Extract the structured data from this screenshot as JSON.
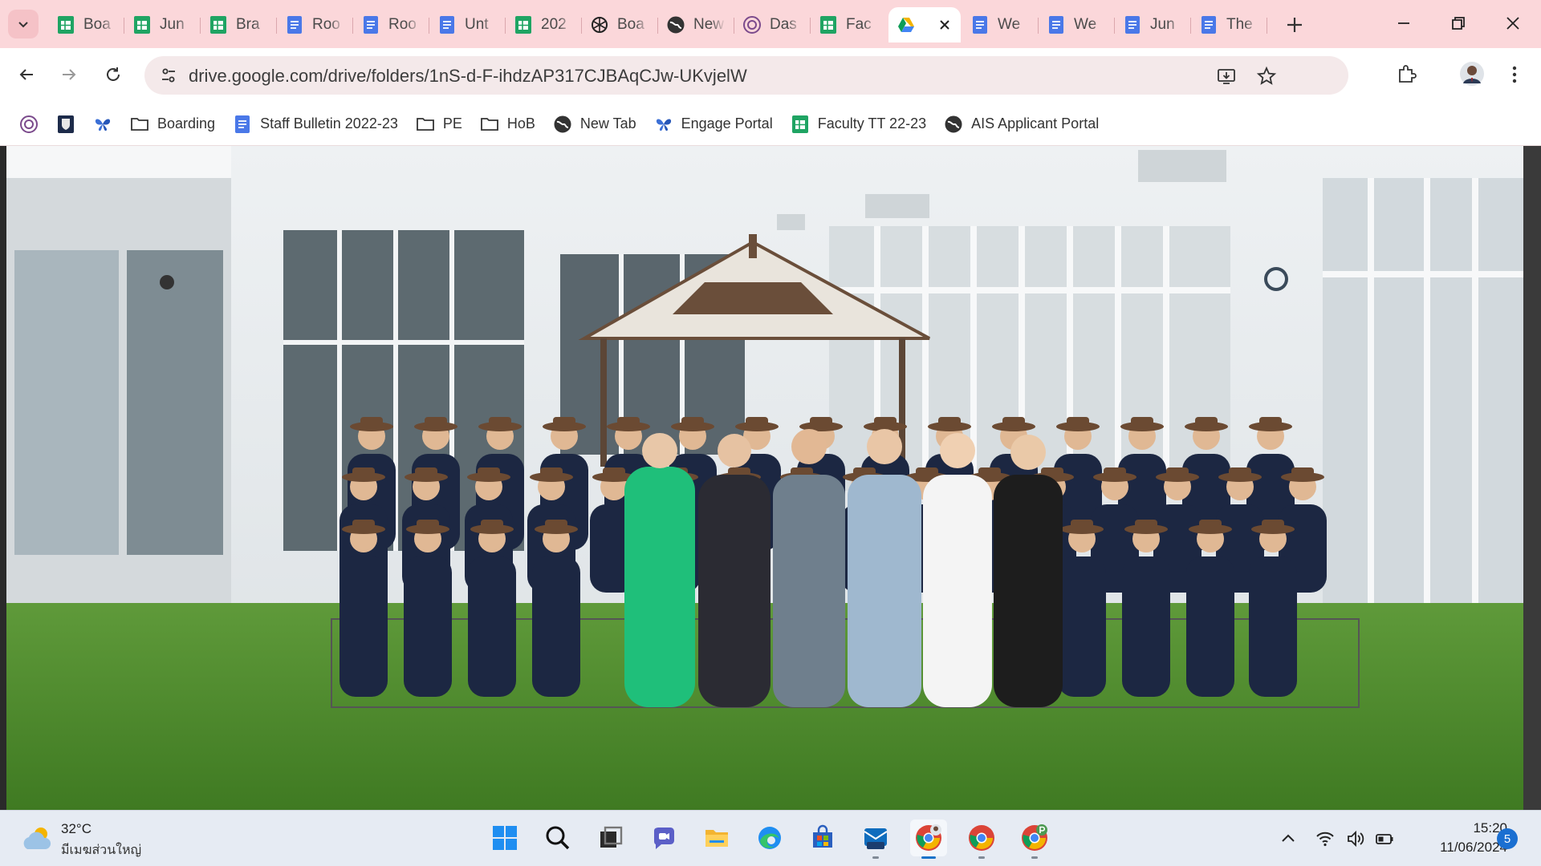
{
  "browser": {
    "tabs": [
      {
        "label": "Boa",
        "icon": "sheets-icon"
      },
      {
        "label": "Jun",
        "icon": "sheets-icon"
      },
      {
        "label": "Bra",
        "icon": "sheets-icon"
      },
      {
        "label": "Roo",
        "icon": "docs-icon"
      },
      {
        "label": "Roo",
        "icon": "docs-icon"
      },
      {
        "label": "Unt",
        "icon": "docs-icon"
      },
      {
        "label": "202",
        "icon": "sheets-icon"
      },
      {
        "label": "Boa",
        "icon": "openai-icon"
      },
      {
        "label": "New",
        "icon": "chrome-globe-icon"
      },
      {
        "label": "Das",
        "icon": "target-icon"
      },
      {
        "label": "Fac",
        "icon": "sheets-icon"
      },
      {
        "label": "",
        "icon": "google-drive-icon",
        "active": true
      },
      {
        "label": "We",
        "icon": "docs-icon"
      },
      {
        "label": "We",
        "icon": "docs-icon"
      },
      {
        "label": "Jun",
        "icon": "docs-icon"
      },
      {
        "label": "The",
        "icon": "docs-icon"
      }
    ],
    "url": "drive.google.com/drive/folders/1nS-d-F-ihdzAP317CJBAqCJw-UKvjelW",
    "bookmarks": [
      {
        "label": "",
        "icon": "target-icon"
      },
      {
        "label": "",
        "icon": "school-crest-icon"
      },
      {
        "label": "",
        "icon": "butterfly-icon"
      },
      {
        "label": "Boarding",
        "icon": "folder-icon"
      },
      {
        "label": "Staff Bulletin 2022-23",
        "icon": "docs-icon"
      },
      {
        "label": "PE",
        "icon": "folder-icon"
      },
      {
        "label": "HoB",
        "icon": "folder-icon"
      },
      {
        "label": "New Tab",
        "icon": "chrome-globe-icon"
      },
      {
        "label": "Engage Portal",
        "icon": "butterfly-icon"
      },
      {
        "label": "Faculty TT 22-23",
        "icon": "sheets-icon"
      },
      {
        "label": "AIS Applicant Portal",
        "icon": "chrome-globe-icon"
      }
    ]
  },
  "taskbar": {
    "weather_temp": "32°C",
    "weather_desc": "มีเมฆส่วนใหญ่",
    "time": "15:20",
    "date": "11/06/2024",
    "notification_count": "5",
    "apps": [
      "windows-start-icon",
      "search-icon",
      "task-view-icon",
      "teams-chat-icon",
      "file-explorer-icon",
      "edge-icon",
      "store-icon",
      "outlook-new-icon",
      "chrome-profile-icon",
      "chrome-icon",
      "chrome-profile-p-icon"
    ]
  },
  "colors": {
    "tabstrip": "#fbd7da",
    "sheets": "#1fa463",
    "docs": "#4a78e8",
    "taskbar": "#e6ebf3"
  }
}
